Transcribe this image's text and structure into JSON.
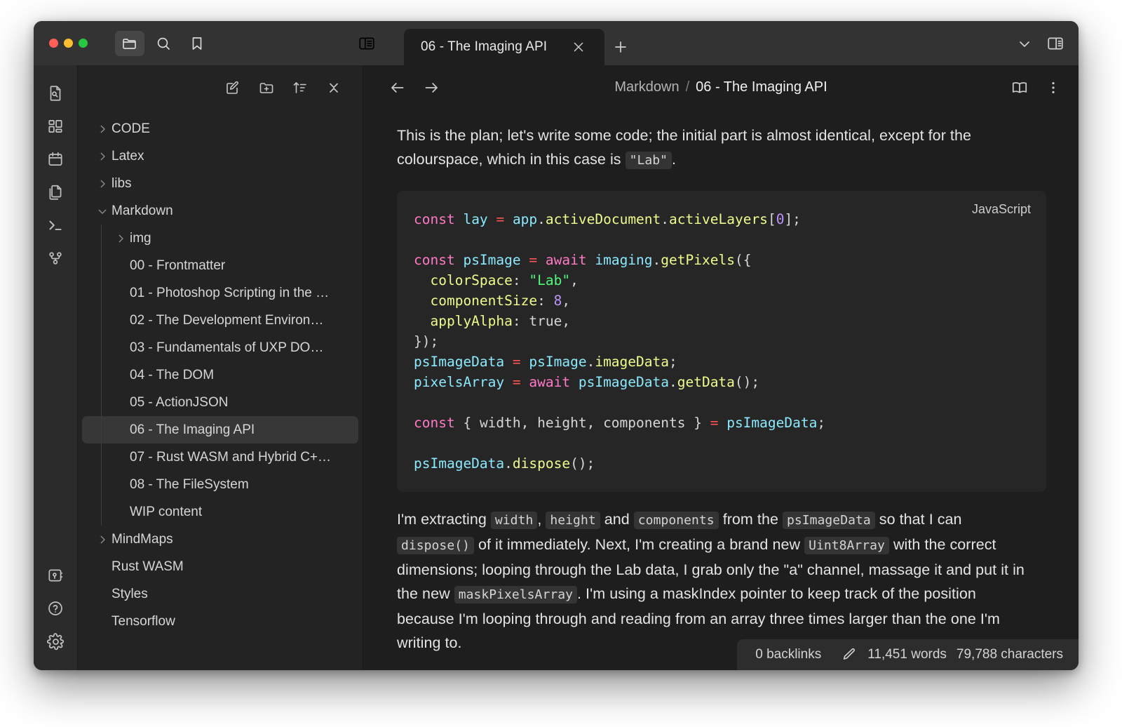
{
  "window": {
    "traffic_lights": [
      "close",
      "minimize",
      "zoom"
    ],
    "toolbar_icons": [
      "folder-icon",
      "search-icon",
      "bookmark-icon",
      "panel-layout-icon"
    ],
    "titlebar_right_icons": [
      "chevron-down-icon",
      "right-panel-icon"
    ]
  },
  "tabs": [
    {
      "label": "06 - The Imaging API",
      "active": true,
      "close_label": "×"
    }
  ],
  "new_tab_label": "+",
  "activity_bar": {
    "top_items": [
      {
        "name": "file-search-icon",
        "label": "Search in files"
      },
      {
        "name": "dashboard-grid-icon",
        "label": "Dashboard"
      },
      {
        "name": "calendar-icon",
        "label": "Calendar"
      },
      {
        "name": "copy-files-icon",
        "label": "Files"
      },
      {
        "name": "terminal-icon",
        "label": "Terminal"
      },
      {
        "name": "git-branch-icon",
        "label": "Version control"
      }
    ],
    "bottom_items": [
      {
        "name": "vault-icon",
        "label": "Vault"
      },
      {
        "name": "help-icon",
        "label": "Help"
      },
      {
        "name": "settings-gear-icon",
        "label": "Settings"
      }
    ]
  },
  "sidebar": {
    "toolbar_icons": [
      {
        "name": "new-note-icon",
        "label": "New note"
      },
      {
        "name": "new-folder-icon",
        "label": "New folder"
      },
      {
        "name": "sort-icon",
        "label": "Change sort order"
      },
      {
        "name": "collapse-all-icon",
        "label": "Collapse all"
      }
    ],
    "tree": [
      {
        "label": "CODE",
        "type": "folder",
        "depth": 1,
        "expanded": false,
        "selected": false
      },
      {
        "label": "Latex",
        "type": "folder",
        "depth": 1,
        "expanded": false,
        "selected": false
      },
      {
        "label": "libs",
        "type": "folder",
        "depth": 1,
        "expanded": false,
        "selected": false
      },
      {
        "label": "Markdown",
        "type": "folder",
        "depth": 1,
        "expanded": true,
        "selected": false
      },
      {
        "label": "img",
        "type": "folder",
        "depth": 2,
        "expanded": false,
        "selected": false
      },
      {
        "label": "00 - Frontmatter",
        "type": "file",
        "depth": 2,
        "expanded": false,
        "selected": false
      },
      {
        "label": "01 - Photoshop Scripting in the …",
        "type": "file",
        "depth": 2,
        "expanded": false,
        "selected": false
      },
      {
        "label": "02 - The Development Environ…",
        "type": "file",
        "depth": 2,
        "expanded": false,
        "selected": false
      },
      {
        "label": "03 - Fundamentals of UXP DO…",
        "type": "file",
        "depth": 2,
        "expanded": false,
        "selected": false
      },
      {
        "label": "04 - The DOM",
        "type": "file",
        "depth": 2,
        "expanded": false,
        "selected": false
      },
      {
        "label": "05 - ActionJSON",
        "type": "file",
        "depth": 2,
        "expanded": false,
        "selected": false
      },
      {
        "label": "06 - The Imaging API",
        "type": "file",
        "depth": 2,
        "expanded": false,
        "selected": true
      },
      {
        "label": "07 - Rust WASM and Hybrid C+…",
        "type": "file",
        "depth": 2,
        "expanded": false,
        "selected": false
      },
      {
        "label": "08 - The FileSystem",
        "type": "file",
        "depth": 2,
        "expanded": false,
        "selected": false
      },
      {
        "label": "WIP content",
        "type": "file",
        "depth": 2,
        "expanded": false,
        "selected": false
      },
      {
        "label": "MindMaps",
        "type": "folder",
        "depth": 1,
        "expanded": false,
        "selected": false
      },
      {
        "label": "Rust WASM",
        "type": "file",
        "depth": 1,
        "expanded": false,
        "selected": false
      },
      {
        "label": "Styles",
        "type": "file",
        "depth": 1,
        "expanded": false,
        "selected": false
      },
      {
        "label": "Tensorflow",
        "type": "file",
        "depth": 1,
        "expanded": false,
        "selected": false
      }
    ]
  },
  "editor": {
    "nav_icons": [
      {
        "name": "back-arrow-icon",
        "label": "Back"
      },
      {
        "name": "forward-arrow-icon",
        "label": "Forward"
      }
    ],
    "breadcrumb": {
      "parent": "Markdown",
      "separator": "/",
      "current": "06 - The Imaging API"
    },
    "header_right_icons": [
      {
        "name": "reading-mode-icon",
        "label": "Reading mode"
      },
      {
        "name": "more-options-icon",
        "label": "More options"
      }
    ],
    "paragraph_1": {
      "part_a": "This is the plan; let's write some code; the initial part is almost identical, except for the colourspace, which in this case is ",
      "code": "\"Lab\"",
      "part_b": "."
    },
    "codeblock": {
      "language": "JavaScript",
      "lines": [
        "const lay = app.activeDocument.activeLayers[0];",
        "",
        "const psImage = await imaging.getPixels({",
        "  colorSpace: \"Lab\",",
        "  componentSize: 8,",
        "  applyAlpha: true,",
        "});",
        "psImageData = psImage.imageData;",
        "pixelsArray = await psImageData.getData();",
        "",
        "const { width, height, components } = psImageData;",
        "",
        "psImageData.dispose();"
      ]
    },
    "paragraph_2": {
      "s1": "I'm extracting ",
      "c1": "width",
      "s2": ", ",
      "c2": "height",
      "s3": " and ",
      "c3": "components",
      "s4": " from the ",
      "c4": "psImageData",
      "s5": " so that I can ",
      "c5": "dispose()",
      "s6": " of it immediately. Next, I'm creating a brand new ",
      "c6": "Uint8Array",
      "s7": " with the correct dimensions; looping through the Lab data, I grab only the \"a\" channel, massage it and put it in the new ",
      "c7": "maskPixelsArray",
      "s8": ". I'm using a maskIndex pointer to keep track of the position because I'm looping through and reading from an array three times larger than the one I'm writing to."
    }
  },
  "statusbar": {
    "backlinks": "0 backlinks",
    "edit_icon": "pencil-icon",
    "words": "11,451 words",
    "characters": "79,788 characters"
  },
  "colors": {
    "window_bg": "#1e1e1e",
    "titlebar_bg": "#333333",
    "sidebar_bg": "#232323",
    "activitybar_bg": "#2b2b2b",
    "code_bg": "#262626",
    "selection_bg": "#373737",
    "accent_keyword": "#ff79c6",
    "accent_string": "#50fa7b",
    "accent_variable": "#8be9fd",
    "accent_property": "#f1fa8c",
    "accent_number": "#bd93f9",
    "accent_operator": "#ff5555"
  }
}
